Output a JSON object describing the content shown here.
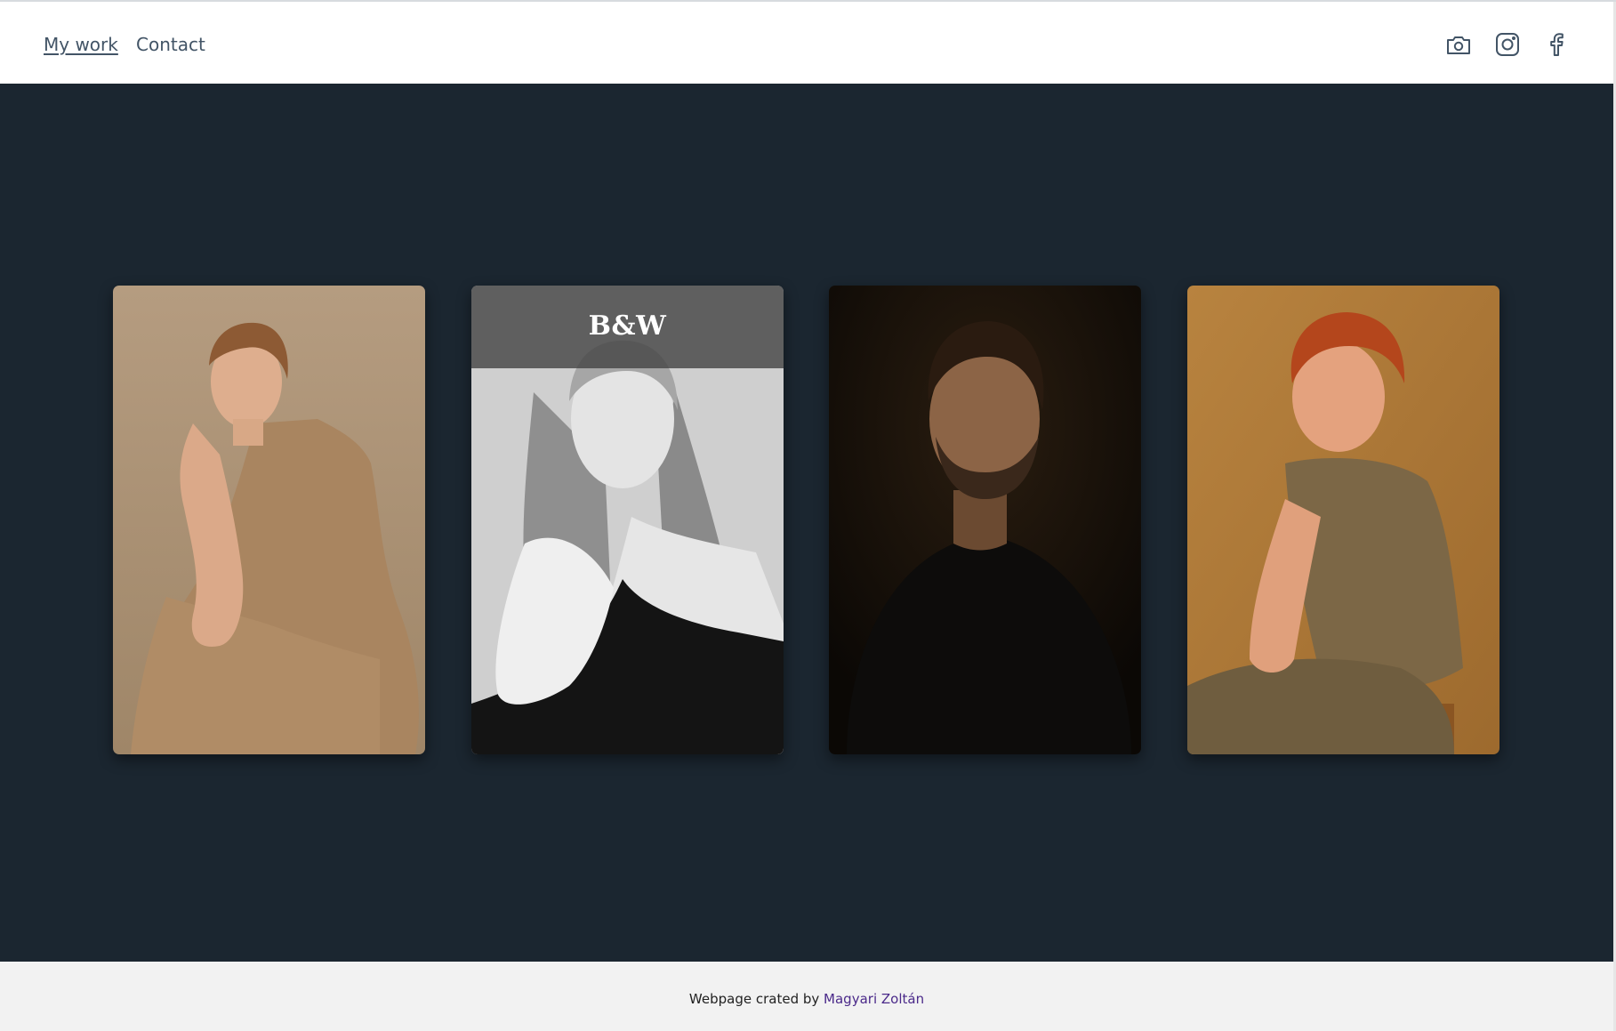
{
  "header": {
    "nav": [
      {
        "label": "My work",
        "active": true
      },
      {
        "label": "Contact",
        "active": false
      }
    ],
    "social_icons": [
      "camera-icon",
      "instagram-icon",
      "facebook-icon"
    ]
  },
  "gallery": {
    "cards": [
      {
        "subject": "woman-warm-tone",
        "overlay": ""
      },
      {
        "subject": "woman-black-white",
        "overlay": "B&W"
      },
      {
        "subject": "man-dark-tone",
        "overlay": ""
      },
      {
        "subject": "boy-warm-tone",
        "overlay": ""
      }
    ]
  },
  "footer": {
    "prefix": "Webpage crated by",
    "author": "Magyari Zoltán"
  },
  "colors": {
    "header_bg": "#ffffff",
    "page_bg": "#1b2630",
    "nav_text": "#425466",
    "footer_bg": "#f2f2f2",
    "footer_link": "#4b2a8a"
  }
}
